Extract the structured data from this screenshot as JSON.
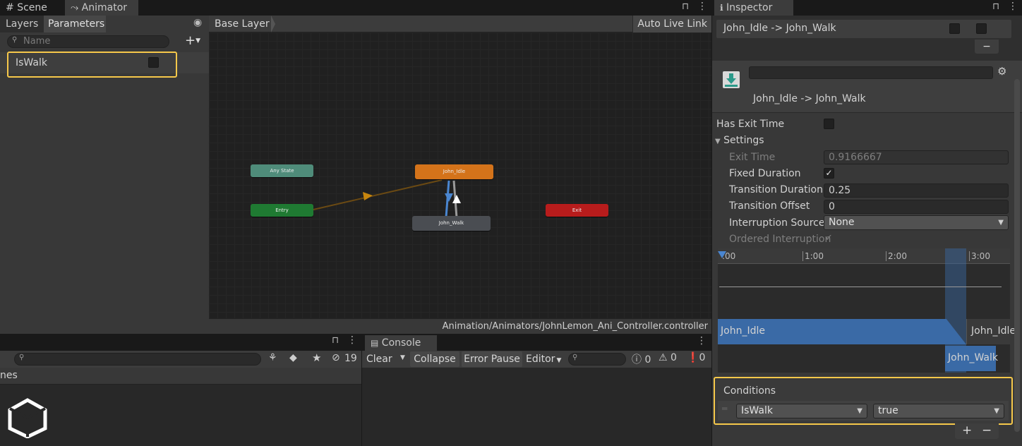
{
  "tabs": {
    "scene": "Scene",
    "animator": "Animator",
    "inspector": "Inspector",
    "console": "Console"
  },
  "animator": {
    "layers_tab": "Layers",
    "parameters_tab": "Parameters",
    "search_placeholder": "Name",
    "parameter": {
      "name": "IsWalk",
      "value": false
    },
    "breadcrumb": "Base Layer",
    "auto_live_link": "Auto Live Link",
    "path": "Animation/Animators/JohnLemon_Ani_Controller.controller",
    "nodes": {
      "any_state": "Any State",
      "entry": "Entry",
      "john_idle": "John_Idle",
      "john_walk": "John_Walk",
      "exit": "Exit"
    }
  },
  "inspector": {
    "transition_list_item": "John_Idle -> John_Walk",
    "transition_title": "John_Idle -> John_Walk",
    "has_exit_time_label": "Has Exit Time",
    "has_exit_time": false,
    "settings_label": "Settings",
    "exit_time_label": "Exit Time",
    "exit_time_value": "0.9166667",
    "fixed_duration_label": "Fixed Duration",
    "fixed_duration": true,
    "transition_duration_label": "Transition Duration",
    "transition_duration_value": "0.25",
    "transition_offset_label": "Transition Offset",
    "transition_offset_value": "0",
    "interruption_source_label": "Interruption Source",
    "interruption_source_value": "None",
    "ordered_interruption_label": "Ordered Interruption",
    "ordered_interruption": true,
    "timeline": {
      "ticks": [
        ":00",
        "1:00",
        "2:00",
        "3:00"
      ],
      "source_state": "John_Idle",
      "source_state_right": "John_Idle",
      "dest_state": "John_Walk"
    },
    "conditions_label": "Conditions",
    "condition": {
      "parameter": "IsWalk",
      "value": "true"
    },
    "add_button": "+",
    "remove_button": "−"
  },
  "project": {
    "search_placeholder": "",
    "hidden_count": "19",
    "partial_label": "nes"
  },
  "console": {
    "clear": "Clear",
    "collapse": "Collapse",
    "error_pause": "Error Pause",
    "editor": "Editor",
    "log_count": "0",
    "warning_count": "0",
    "error_count": "0"
  },
  "colors": {
    "highlight": "#f6c84a",
    "idle_node": "#d4731a",
    "entry_node": "#1f7a32",
    "any_state_node": "#4f8c7a",
    "exit_node": "#b81c1c",
    "walk_node": "#4a4d52",
    "timeline_blue": "#3a6aa6"
  }
}
